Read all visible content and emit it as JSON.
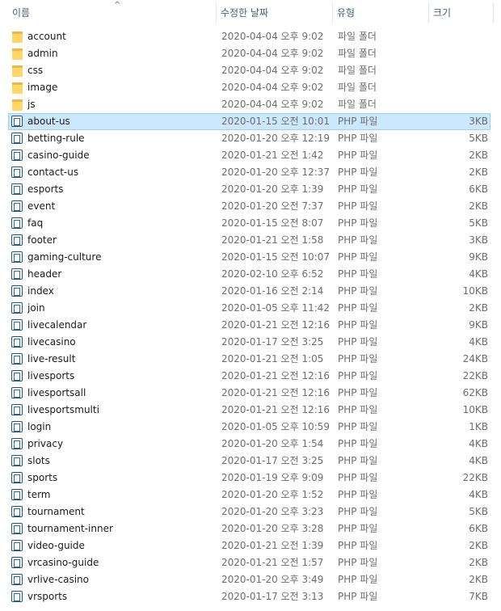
{
  "columns": {
    "name": "이름",
    "date": "수정한 날짜",
    "type": "유형",
    "size": "크기",
    "sort_glyph": "^"
  },
  "files": [
    {
      "name": "account",
      "date": "2020-04-04 오후 9:02",
      "type": "파일 폴더",
      "size": "",
      "kind": "folder-icon"
    },
    {
      "name": "admin",
      "date": "2020-04-04 오후 9:02",
      "type": "파일 폴더",
      "size": "",
      "kind": "folder-icon"
    },
    {
      "name": "css",
      "date": "2020-04-04 오후 9:02",
      "type": "파일 폴더",
      "size": "",
      "kind": "folder-icon"
    },
    {
      "name": "image",
      "date": "2020-04-04 오후 9:02",
      "type": "파일 폴더",
      "size": "",
      "kind": "folder-icon"
    },
    {
      "name": "js",
      "date": "2020-04-04 오후 9:02",
      "type": "파일 폴더",
      "size": "",
      "kind": "folder-icon"
    },
    {
      "name": "about-us",
      "date": "2020-01-15 오전 10:01",
      "type": "PHP 파일",
      "size": "3KB",
      "kind": "php-file-icon",
      "selected": true
    },
    {
      "name": "betting-rule",
      "date": "2020-01-20 오후 12:19",
      "type": "PHP 파일",
      "size": "5KB",
      "kind": "php-file-icon"
    },
    {
      "name": "casino-guide",
      "date": "2020-01-21 오전 1:42",
      "type": "PHP 파일",
      "size": "2KB",
      "kind": "php-file-icon"
    },
    {
      "name": "contact-us",
      "date": "2020-01-20 오후 12:37",
      "type": "PHP 파일",
      "size": "2KB",
      "kind": "php-file-icon"
    },
    {
      "name": "esports",
      "date": "2020-01-20 오후 1:39",
      "type": "PHP 파일",
      "size": "6KB",
      "kind": "php-file-icon"
    },
    {
      "name": "event",
      "date": "2020-01-20 오전 7:37",
      "type": "PHP 파일",
      "size": "2KB",
      "kind": "php-file-icon"
    },
    {
      "name": "faq",
      "date": "2020-01-15 오전 8:07",
      "type": "PHP 파일",
      "size": "5KB",
      "kind": "php-file-icon"
    },
    {
      "name": "footer",
      "date": "2020-01-21 오전 1:58",
      "type": "PHP 파일",
      "size": "3KB",
      "kind": "php-file-icon"
    },
    {
      "name": "gaming-culture",
      "date": "2020-01-15 오전 10:07",
      "type": "PHP 파일",
      "size": "9KB",
      "kind": "php-file-icon"
    },
    {
      "name": "header",
      "date": "2020-02-10 오후 6:52",
      "type": "PHP 파일",
      "size": "4KB",
      "kind": "php-file-icon"
    },
    {
      "name": "index",
      "date": "2020-01-16 오전 2:14",
      "type": "PHP 파일",
      "size": "10KB",
      "kind": "php-file-icon"
    },
    {
      "name": "join",
      "date": "2020-01-05 오후 11:42",
      "type": "PHP 파일",
      "size": "2KB",
      "kind": "php-file-icon"
    },
    {
      "name": "livecalendar",
      "date": "2020-01-21 오전 12:16",
      "type": "PHP 파일",
      "size": "9KB",
      "kind": "php-file-icon"
    },
    {
      "name": "livecasino",
      "date": "2020-01-17 오전 3:25",
      "type": "PHP 파일",
      "size": "4KB",
      "kind": "php-file-icon"
    },
    {
      "name": "live-result",
      "date": "2020-01-21 오전 1:05",
      "type": "PHP 파일",
      "size": "24KB",
      "kind": "php-file-icon"
    },
    {
      "name": "livesports",
      "date": "2020-01-21 오전 12:16",
      "type": "PHP 파일",
      "size": "22KB",
      "kind": "php-file-icon"
    },
    {
      "name": "livesportsall",
      "date": "2020-01-21 오전 12:16",
      "type": "PHP 파일",
      "size": "62KB",
      "kind": "php-file-icon"
    },
    {
      "name": "livesportsmulti",
      "date": "2020-01-21 오전 12:16",
      "type": "PHP 파일",
      "size": "10KB",
      "kind": "php-file-icon"
    },
    {
      "name": "login",
      "date": "2020-01-05 오후 10:59",
      "type": "PHP 파일",
      "size": "1KB",
      "kind": "php-file-icon"
    },
    {
      "name": "privacy",
      "date": "2020-01-20 오후 1:54",
      "type": "PHP 파일",
      "size": "4KB",
      "kind": "php-file-icon"
    },
    {
      "name": "slots",
      "date": "2020-01-17 오전 3:25",
      "type": "PHP 파일",
      "size": "4KB",
      "kind": "php-file-icon"
    },
    {
      "name": "sports",
      "date": "2020-01-19 오후 9:09",
      "type": "PHP 파일",
      "size": "22KB",
      "kind": "php-file-icon"
    },
    {
      "name": "term",
      "date": "2020-01-20 오후 1:52",
      "type": "PHP 파일",
      "size": "4KB",
      "kind": "php-file-icon"
    },
    {
      "name": "tournament",
      "date": "2020-01-20 오후 3:23",
      "type": "PHP 파일",
      "size": "5KB",
      "kind": "php-file-icon"
    },
    {
      "name": "tournament-inner",
      "date": "2020-01-20 오후 3:28",
      "type": "PHP 파일",
      "size": "6KB",
      "kind": "php-file-icon"
    },
    {
      "name": "video-guide",
      "date": "2020-01-21 오전 1:39",
      "type": "PHP 파일",
      "size": "2KB",
      "kind": "php-file-icon"
    },
    {
      "name": "vrcasino-guide",
      "date": "2020-01-21 오전 1:57",
      "type": "PHP 파일",
      "size": "2KB",
      "kind": "php-file-icon"
    },
    {
      "name": "vrlive-casino",
      "date": "2020-01-20 오후 3:49",
      "type": "PHP 파일",
      "size": "2KB",
      "kind": "php-file-icon"
    },
    {
      "name": "vrsports",
      "date": "2020-01-17 오전 3:13",
      "type": "PHP 파일",
      "size": "7KB",
      "kind": "php-file-icon"
    }
  ],
  "colors": {
    "selection_fill": "#cce8ff",
    "selection_border": "#99d1ff",
    "header_text": "#4c607a",
    "folder": "#ffd767"
  }
}
